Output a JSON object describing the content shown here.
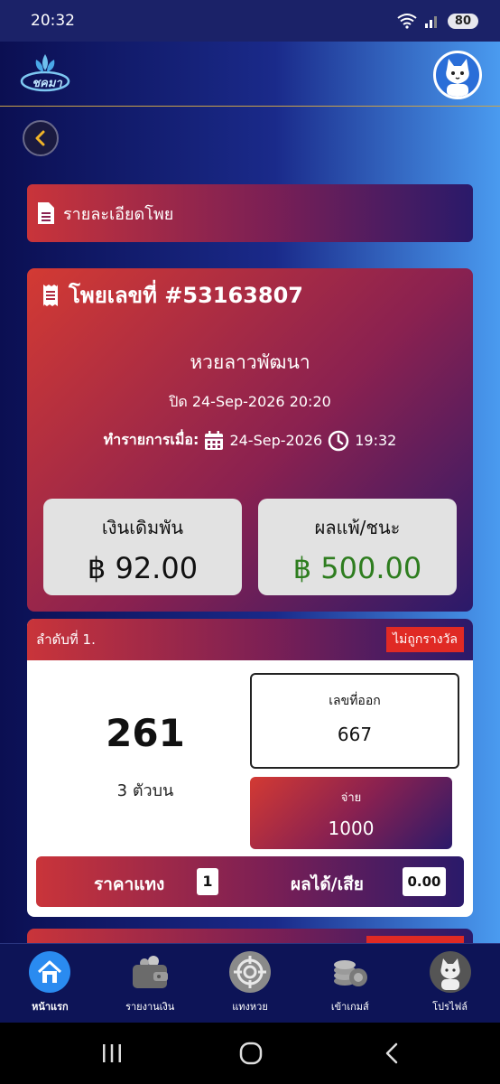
{
  "status_bar": {
    "time": "20:32",
    "battery": "80"
  },
  "header": {
    "logo_text": "ชคมา"
  },
  "detail_section": {
    "title": "รายละเอียดโพย"
  },
  "ticket": {
    "title": "โพยเลขที่ #53163807",
    "lottery_name": "หวยลาวพัฒนา",
    "close_time": "ปิด 24-Sep-2026 20:20",
    "transaction_label": "ทำรายการเมื่อ:",
    "transaction_date": "24-Sep-2026",
    "transaction_time": "19:32",
    "stake_label": "เงินเดิมพัน",
    "stake_value": "฿ 92.00",
    "result_label": "ผลแพ้/ชนะ",
    "result_value": "฿ 500.00"
  },
  "bet_item": {
    "order_label": "ลำดับที่ 1.",
    "status_badge": "ไม่ถูกรางวัล",
    "number": "261",
    "bet_type": "3 ตัวบน",
    "drawn_label": "เลขที่ออก",
    "drawn_value": "667",
    "pay_label": "จ่าย",
    "pay_value": "1000",
    "price_label": "ราคาแทง",
    "price_value": "1",
    "profit_label": "ผลได้/เสีย",
    "profit_value": "0.00"
  },
  "bottom_nav": {
    "items": [
      {
        "label": "หน้าแรก",
        "icon": "home-icon"
      },
      {
        "label": "รายงานเงิน",
        "icon": "wallet-icon"
      },
      {
        "label": "แทงหวย",
        "icon": "target-icon"
      },
      {
        "label": "เข้าเกมส์",
        "icon": "casino-chips-icon"
      },
      {
        "label": "โปรไฟล์",
        "icon": "profile-avatar-icon"
      }
    ]
  },
  "colors": {
    "accent_red": "#d33a33",
    "win_green": "#2e7d1f",
    "gold_back": "#f0b429",
    "nav_active": "#2a8bf0"
  }
}
